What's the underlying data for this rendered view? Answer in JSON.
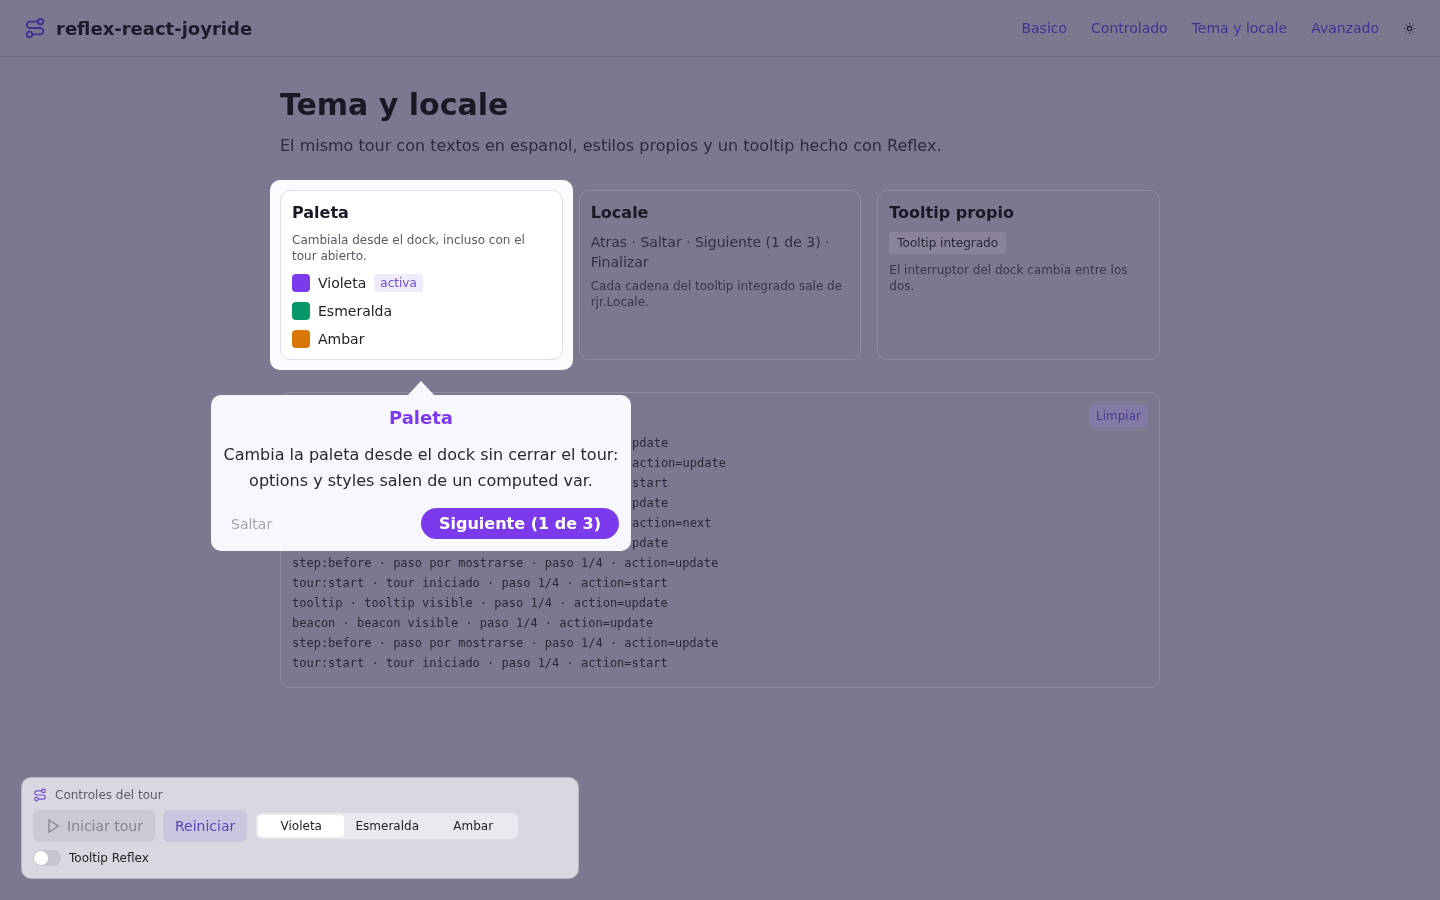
{
  "header": {
    "brand": "reflex-react-joyride",
    "nav": [
      "Basico",
      "Controlado",
      "Tema y locale",
      "Avanzado"
    ]
  },
  "page": {
    "title": "Tema y locale",
    "subtitle": "El mismo tour con textos en espanol, estilos propios y un tooltip hecho con Reflex."
  },
  "cards": [
    {
      "kind": "palette",
      "title": "Paleta",
      "description": "Cambiala desde el dock, incluso con el tour abierto.",
      "active_badge": "activa",
      "spotlight": true,
      "options": [
        {
          "label": "Violeta",
          "color": "#7c3aed",
          "selected": true
        },
        {
          "label": "Esmeralda",
          "color": "#059669",
          "selected": false
        },
        {
          "label": "Ambar",
          "color": "#d97706",
          "selected": false
        }
      ]
    },
    {
      "kind": "locale",
      "title": "Locale",
      "text": "Atras · Saltar · Siguiente (1 de 3) · Finalizar",
      "note": "Cada cadena del tooltip integrado sale de rjr.Locale.",
      "spotlight": false
    },
    {
      "kind": "tooltip",
      "title": "Tooltip propio",
      "badge": "Tooltip integrado",
      "text": "El interruptor del dock cambia entre los dos.",
      "spotlight": false
    }
  ],
  "log": {
    "clear_button": "Limpiar",
    "lines": [
      {
        "kind": "cut",
        "text": "pdate"
      },
      {
        "kind": "cut",
        "text": "action=update"
      },
      {
        "kind": "cut",
        "text": "start"
      },
      {
        "kind": "cut",
        "text": "pdate"
      },
      {
        "kind": "cut",
        "text": "action=next"
      },
      {
        "kind": "cut",
        "text": "pdate"
      },
      {
        "kind": "full",
        "text": "step:before · paso por mostrarse · paso 1/4 · action=update"
      },
      {
        "kind": "full",
        "text": "tour:start · tour iniciado · paso 1/4 · action=start"
      },
      {
        "kind": "full",
        "text": "tooltip · tooltip visible · paso 1/4 · action=update"
      },
      {
        "kind": "full",
        "text": "beacon · beacon visible · paso 1/4 · action=update"
      },
      {
        "kind": "full",
        "text": "step:before · paso por mostrarse · paso 1/4 · action=update"
      },
      {
        "kind": "full",
        "text": "tour:start · tour iniciado · paso 1/4 · action=start"
      }
    ]
  },
  "tooltip": {
    "title": "Paleta",
    "body": "Cambia la paleta desde el dock sin cerrar el tour: options y styles salen de un computed var.",
    "skip": "Saltar",
    "next": "Siguiente (1 de 3)"
  },
  "dock": {
    "title": "Controles del tour",
    "start_button": {
      "label": "Iniciar tour",
      "disabled": true
    },
    "restart_button": {
      "label": "Reiniciar",
      "disabled": false
    },
    "segments": [
      {
        "label": "Violeta",
        "selected": true
      },
      {
        "label": "Esmeralda",
        "selected": false
      },
      {
        "label": "Ambar",
        "selected": false
      }
    ],
    "switch": {
      "label": "Tooltip Reflex",
      "on": false
    }
  }
}
